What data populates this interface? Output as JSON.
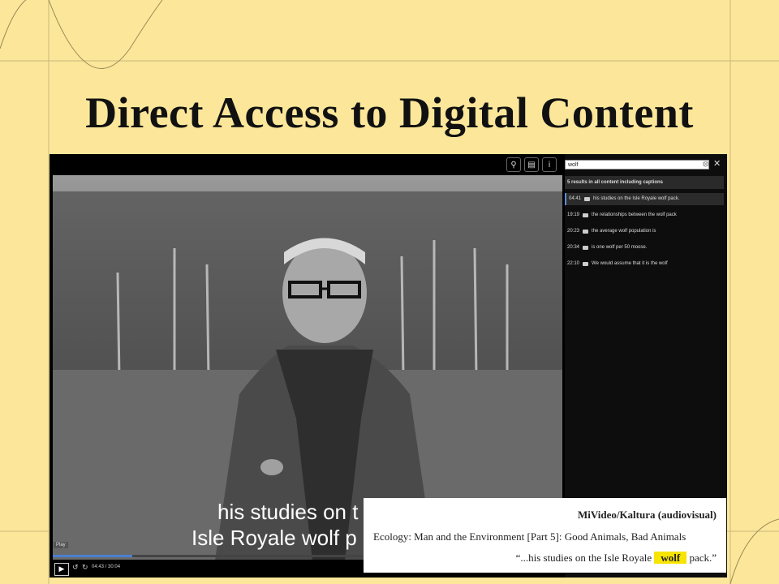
{
  "slide": {
    "title": "Direct Access to Digital Content"
  },
  "player": {
    "top_icons": [
      "search-icon",
      "captions-icon",
      "info-icon"
    ],
    "search": {
      "value": "wolf"
    },
    "results_summary": "5 results in all content including captions",
    "results": [
      {
        "time": "04:41",
        "text": "his studies on the Isle Royale wolf pack."
      },
      {
        "time": "19:19",
        "text": "the relationships between the wolf pack"
      },
      {
        "time": "20:23",
        "text": "the average wolf population is"
      },
      {
        "time": "20:34",
        "text": "is one wolf per 50 moose."
      },
      {
        "time": "22:10",
        "text": "We would assume that it is the wolf"
      }
    ],
    "caption_lines": [
      "his studies on t",
      "Isle Royale wolf p"
    ],
    "controls": {
      "play_tooltip": "Play",
      "time": "04:43 / 30:04",
      "progress": 0.156
    }
  },
  "citation": {
    "title": "MiVideo/Kaltura (audiovisual)",
    "description": "Ecology: Man and the Environment [Part 5]: Good Animals, Bad Animals",
    "quote_before": "“...his studies on the Isle Royale",
    "quote_highlight": "wolf",
    "quote_after": "pack.”"
  },
  "colors": {
    "background": "#fbe69a",
    "highlight": "#f7e400",
    "accent": "#4a7fd0"
  }
}
